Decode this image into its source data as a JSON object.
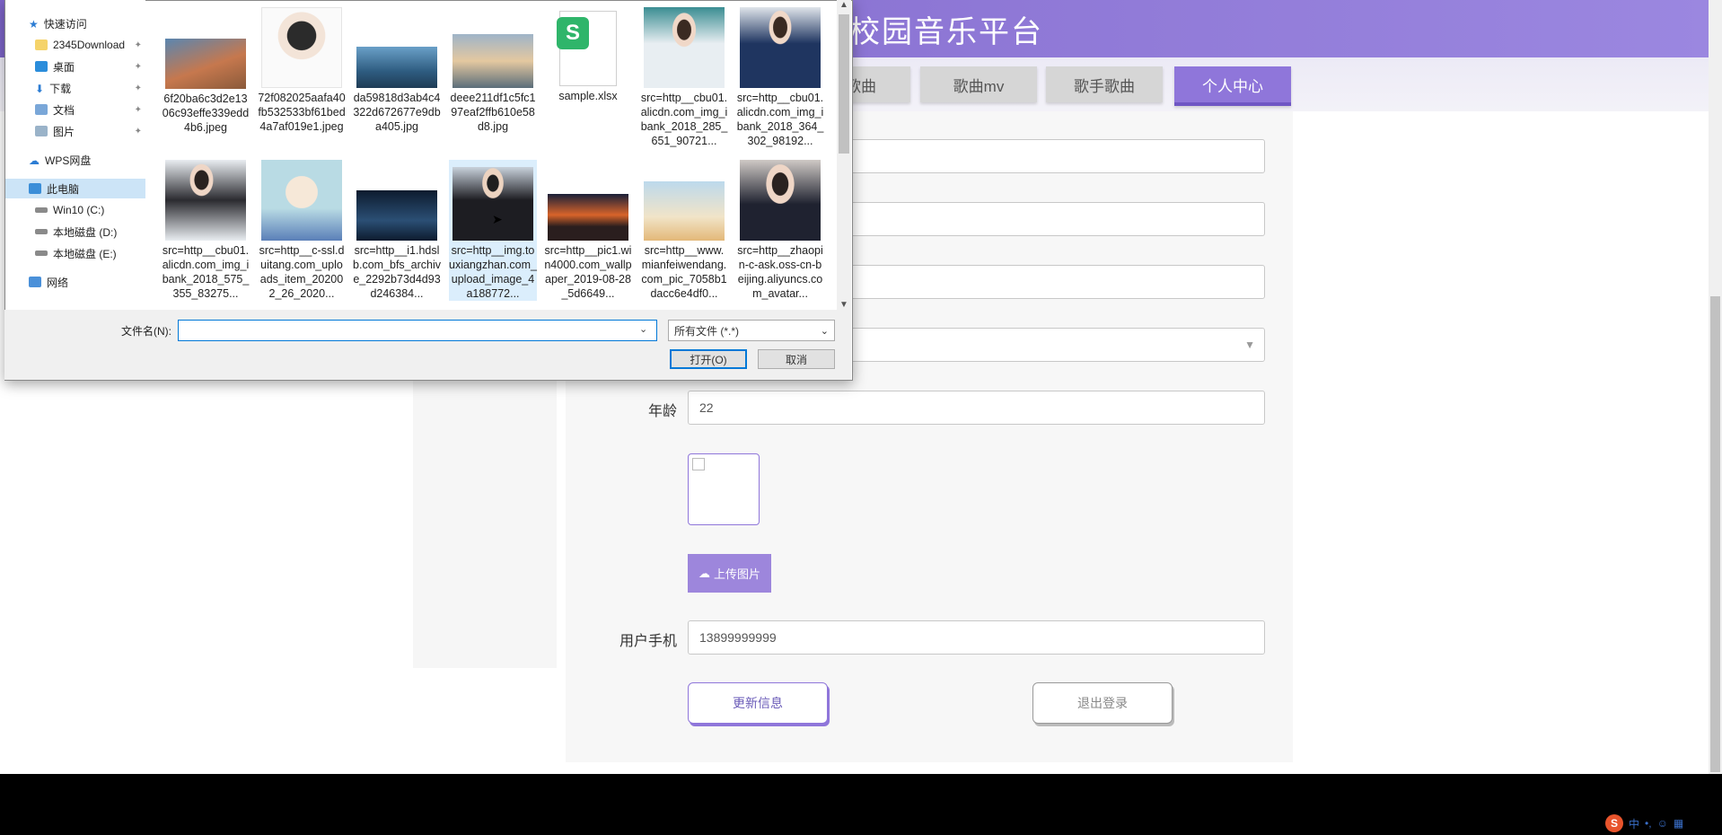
{
  "header": {
    "title": "校园音乐平台"
  },
  "nav": {
    "tabs": [
      {
        "label": "歌曲",
        "active": false
      },
      {
        "label": "歌曲mv",
        "active": false
      },
      {
        "label": "歌手歌曲",
        "active": false
      },
      {
        "label": "个人中心",
        "active": true
      }
    ]
  },
  "form": {
    "age_label": "年龄",
    "age_value": "22",
    "upload_label": "上传图片",
    "phone_label": "用户手机",
    "phone_value": "13899999999",
    "update_label": "更新信息",
    "logout_label": "退出登录"
  },
  "dialog": {
    "sidebar": [
      {
        "label": "快速访问",
        "icon": "star-icon"
      },
      {
        "label": "2345Download",
        "icon": "folder-icon",
        "pinned": true
      },
      {
        "label": "桌面",
        "icon": "desktop-icon",
        "pinned": true
      },
      {
        "label": "下载",
        "icon": "download-icon",
        "pinned": true
      },
      {
        "label": "文档",
        "icon": "document-icon",
        "pinned": true
      },
      {
        "label": "图片",
        "icon": "picture-icon",
        "pinned": true
      },
      {
        "label": "WPS网盘",
        "icon": "cloud-icon"
      },
      {
        "label": "此电脑",
        "icon": "computer-icon",
        "selected": true
      },
      {
        "label": "Win10 (C:)",
        "icon": "drive-icon"
      },
      {
        "label": "本地磁盘 (D:)",
        "icon": "drive-icon"
      },
      {
        "label": "本地磁盘 (E:)",
        "icon": "drive-icon"
      },
      {
        "label": "网络",
        "icon": "network-icon"
      }
    ],
    "files": [
      {
        "name": "6f20ba6c3d2e1306c93effe339edd4b6.jpeg"
      },
      {
        "name": "72f082025aafa40fb532533bf61bed4a7af019e1.jpeg"
      },
      {
        "name": "da59818d3ab4c4322d672677e9dba405.jpg"
      },
      {
        "name": "deee211df1c5fc197eaf2ffb610e58d8.jpg"
      },
      {
        "name": "sample.xlsx"
      },
      {
        "name": "src=http__cbu01.alicdn.com_img_ibank_2018_285_651_90721..."
      },
      {
        "name": "src=http__cbu01.alicdn.com_img_ibank_2018_364_302_98192..."
      },
      {
        "name": "src=http__cbu01.alicdn.com_img_ibank_2018_575_355_83275..."
      },
      {
        "name": "src=http__c-ssl.duitang.com_uploads_item_202002_26_2020..."
      },
      {
        "name": "src=http__i1.hdslb.com_bfs_archive_2292b73d4d93d246384..."
      },
      {
        "name": "src=http__img.touxiangzhan.com_upload_image_4a188772..."
      },
      {
        "name": "src=http__pic1.win4000.com_wallpaper_2019-08-28_5d6649..."
      },
      {
        "name": "src=http__www.mianfeiwendang.com_pic_7058b1dacc6e4df0..."
      },
      {
        "name": "src=http__zhaopin-c-ask.oss-cn-beijing.aliyuncs.com_avatar..."
      }
    ],
    "filename_label": "文件名(N):",
    "filename_value": "",
    "filetype": "所有文件 (*.*)",
    "open_label": "打开(O)",
    "cancel_label": "取消"
  },
  "tray": {
    "ime": "中"
  }
}
